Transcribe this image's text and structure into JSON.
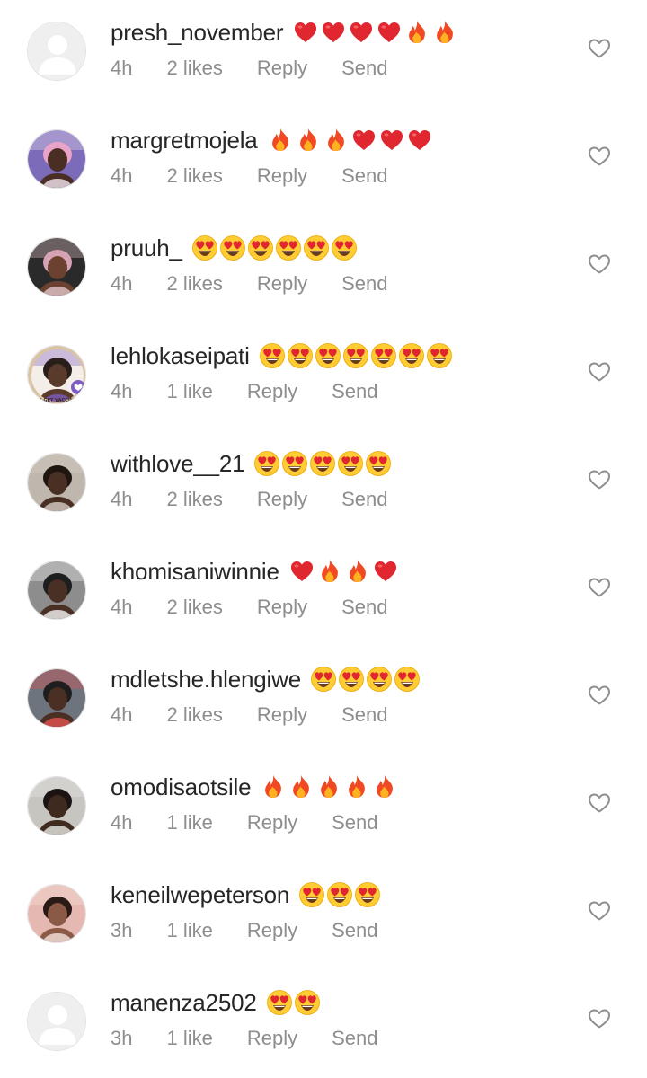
{
  "comments": [
    {
      "username": "presh_november",
      "reactions": [
        "heart",
        "heart",
        "heart",
        "heart",
        "fire",
        "fire"
      ],
      "time": "4h",
      "likes": "2 likes",
      "reply": "Reply",
      "send": "Send",
      "avatar": {
        "kind": "placeholder"
      }
    },
    {
      "username": "margretmojela",
      "reactions": [
        "fire",
        "fire",
        "fire",
        "heart",
        "heart",
        "heart"
      ],
      "time": "4h",
      "likes": "2 likes",
      "reply": "Reply",
      "send": "Send",
      "avatar": {
        "kind": "photo",
        "bg": "#7b6bb8",
        "skin": "#4a2e24",
        "hair": "#e9a3c9",
        "accent": "#f2e6f0"
      }
    },
    {
      "username": "pruuh_",
      "reactions": [
        "heart-eyes",
        "heart-eyes",
        "heart-eyes",
        "heart-eyes",
        "heart-eyes",
        "heart-eyes"
      ],
      "time": "4h",
      "likes": "2 likes",
      "reply": "Reply",
      "send": "Send",
      "avatar": {
        "kind": "photo",
        "bg": "#2b2a2a",
        "skin": "#6b4230",
        "hair": "#d6a3b5",
        "accent": "#e0c6c9"
      }
    },
    {
      "username": "lehlokaseipati",
      "reactions": [
        "heart-eyes",
        "heart-eyes",
        "heart-eyes",
        "heart-eyes",
        "heart-eyes",
        "heart-eyes",
        "heart-eyes"
      ],
      "time": "4h",
      "likes": "1 like",
      "reply": "Reply",
      "send": "Send",
      "avatar": {
        "kind": "badge",
        "bg": "#f3eee7",
        "skin": "#5a3a2a",
        "hair": "#2a1e1a",
        "accent": "#7e5cc4",
        "badge_text": "LET'S GET VACCINATED"
      }
    },
    {
      "username": "withlove__21",
      "reactions": [
        "heart-eyes",
        "heart-eyes",
        "heart-eyes",
        "heart-eyes",
        "heart-eyes"
      ],
      "time": "4h",
      "likes": "2 likes",
      "reply": "Reply",
      "send": "Send",
      "avatar": {
        "kind": "photo",
        "bg": "#bfb7ad",
        "skin": "#4a3024",
        "hair": "#1f1612",
        "accent": "#d7cfc6"
      }
    },
    {
      "username": "khomisaniwinnie",
      "reactions": [
        "heart",
        "fire",
        "fire",
        "heart"
      ],
      "time": "4h",
      "likes": "2 likes",
      "reply": "Reply",
      "send": "Send",
      "avatar": {
        "kind": "photo",
        "bg": "#8d8d8d",
        "skin": "#4a3024",
        "hair": "#1e1e1e",
        "accent": "#f4f4f4"
      }
    },
    {
      "username": "mdletshe.hlengiwe",
      "reactions": [
        "heart-eyes",
        "heart-eyes",
        "heart-eyes",
        "heart-eyes"
      ],
      "time": "4h",
      "likes": "2 likes",
      "reply": "Reply",
      "send": "Send",
      "avatar": {
        "kind": "photo",
        "bg": "#6e747e",
        "skin": "#4a3024",
        "hair": "#1e1e1e",
        "accent": "#e3524f"
      }
    },
    {
      "username": "omodisaotsile",
      "reactions": [
        "fire",
        "fire",
        "fire",
        "fire",
        "fire"
      ],
      "time": "4h",
      "likes": "1 like",
      "reply": "Reply",
      "send": "Send",
      "avatar": {
        "kind": "photo",
        "bg": "#c7c5c0",
        "skin": "#3f2a20",
        "hair": "#1b1412",
        "accent": "#e9e8e4"
      }
    },
    {
      "username": "keneilwepeterson",
      "reactions": [
        "heart-eyes",
        "heart-eyes",
        "heart-eyes"
      ],
      "time": "3h",
      "likes": "1 like",
      "reply": "Reply",
      "send": "Send",
      "avatar": {
        "kind": "photo",
        "bg": "#e5b9b1",
        "skin": "#8a5a46",
        "hair": "#2a1a16",
        "accent": "#f5e2dc"
      }
    },
    {
      "username": "manenza2502",
      "reactions": [
        "heart-eyes",
        "heart-eyes"
      ],
      "time": "3h",
      "likes": "1 like",
      "reply": "Reply",
      "send": "Send",
      "avatar": {
        "kind": "placeholder"
      }
    }
  ],
  "colors": {
    "username": "#262626",
    "meta": "#8e8e8e",
    "heart": "#e0262e",
    "fire_outer": "#f04a24",
    "fire_inner": "#ffb21f",
    "emoji_face": "#ffcc33",
    "emoji_eye_heart": "#e0262e",
    "like_outline": "#8e8e8e",
    "placeholder_bg": "#efefef",
    "placeholder_fg": "#ffffff"
  }
}
